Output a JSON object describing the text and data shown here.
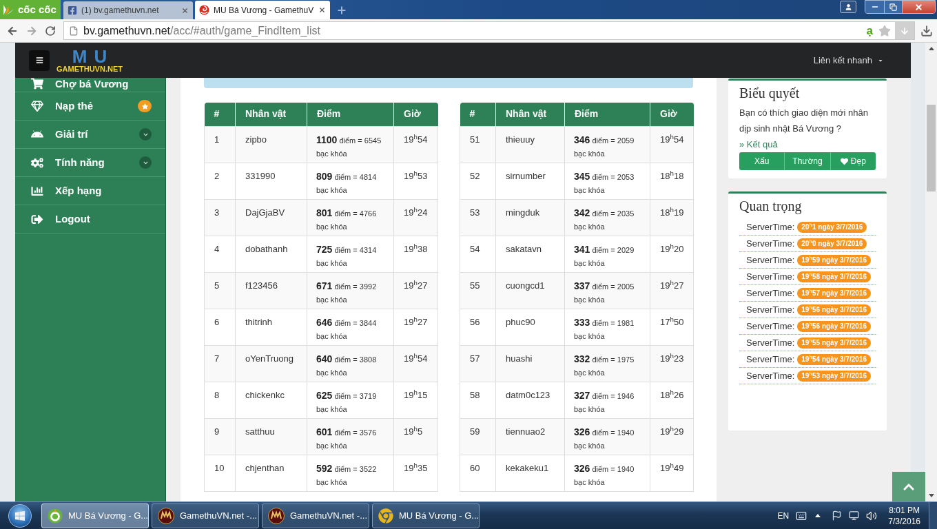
{
  "browser": {
    "brand": "cốc cốc",
    "tabs": [
      {
        "label": "(1) bv.gamethuvn.net",
        "selected": false
      },
      {
        "label": "MU Bá Vương - GamethuV",
        "selected": true
      }
    ],
    "url_host": "bv.gamethuvn.net",
    "url_path": "/acc/#auth/game_FindItem_list",
    "extension_label": "ạ"
  },
  "navbar": {
    "logo_backdrop": "MU",
    "logo_text": "GAMETHUVN.NET",
    "quick_links": "Liên kết nhanh"
  },
  "sidebar": {
    "items": [
      {
        "label": "Chợ bá Vương",
        "kind": "plain"
      },
      {
        "label": "Nạp thẻ",
        "kind": "badge"
      },
      {
        "label": "Giải trí",
        "kind": "submenu"
      },
      {
        "label": "Tính năng",
        "kind": "submenu"
      },
      {
        "label": "Xếp hạng",
        "kind": "plain"
      },
      {
        "label": "Logout",
        "kind": "plain"
      }
    ]
  },
  "tables": [
    {
      "columns": [
        "#",
        "Nhân vật",
        "Điểm",
        "Giờ"
      ],
      "rows": [
        {
          "rank": "1",
          "name": "zipbo",
          "score": "**1100** điểm = 6545 bạc khóa",
          "time": "19$^{h}$54"
        },
        {
          "rank": "2",
          "name": "331990",
          "score": "**809** điểm = 4814 bạc khóa",
          "time": "19$^{h}$53"
        },
        {
          "rank": "3",
          "name": "DajGjaBV",
          "score": "**801** điểm = 4766 bạc khóa",
          "time": "19$^{h}$24"
        },
        {
          "rank": "4",
          "name": "dobathanh",
          "score": "**725** điểm = 4314 bạc khóa",
          "time": "19$^{h}$38"
        },
        {
          "rank": "5",
          "name": "f123456",
          "score": "**671** điểm = 3992 bạc khóa",
          "time": "19$^{h}$27"
        },
        {
          "rank": "6",
          "name": "thitrinh",
          "score": "**646** điểm = 3844 bạc khóa",
          "time": "19$^{h}$27"
        },
        {
          "rank": "7",
          "name": "oYenTruong",
          "score": "**640** điểm = 3808 bạc khóa",
          "time": "19$^{h}$54"
        },
        {
          "rank": "8",
          "name": "chickenkc",
          "score": "**625** điểm = 3719 bạc khóa",
          "time": "19$^{h}$15"
        },
        {
          "rank": "9",
          "name": "satthuu",
          "score": "**601** điểm = 3576 bạc khóa",
          "time": "19$^{h}$5"
        },
        {
          "rank": "10",
          "name": "chjenthan",
          "score": "**592** điểm = 3522 bạc khóa",
          "time": "19$^{h}$35"
        }
      ]
    },
    {
      "columns": [
        "#",
        "Nhân vật",
        "Điểm",
        "Giờ"
      ],
      "rows": [
        {
          "rank": "51",
          "name": "thieuuy",
          "score": "**346** điểm = 2059 bạc khóa",
          "time": "19$^{h}$54"
        },
        {
          "rank": "52",
          "name": "sirnumber",
          "score": "**345** điểm = 2053 bạc khóa",
          "time": "18$^{h}$18"
        },
        {
          "rank": "53",
          "name": "mingduk",
          "score": "**342** điểm = 2035 bạc khóa",
          "time": "18$^{h}$19"
        },
        {
          "rank": "54",
          "name": "sakatavn",
          "score": "**341** điểm = 2029 bạc khóa",
          "time": "19$^{h}$20"
        },
        {
          "rank": "55",
          "name": "cuongcd1",
          "score": "**337** điểm = 2005 bạc khóa",
          "time": "19$^{h}$27"
        },
        {
          "rank": "56",
          "name": "phuc90",
          "score": "**333** điểm = 1981 bạc khóa",
          "time": "17$^{h}$50"
        },
        {
          "rank": "57",
          "name": "huashi",
          "score": "**332** điểm = 1975 bạc khóa",
          "time": "19$^{h}$23"
        },
        {
          "rank": "58",
          "name": "datm0c123",
          "score": "**327** điểm = 1946 bạc khóa",
          "time": "18$^{h}$26"
        },
        {
          "rank": "59",
          "name": "tiennuao2",
          "score": "**326** điểm = 1940 bạc khóa",
          "time": "19$^{h}$29"
        },
        {
          "rank": "60",
          "name": "kekakeku1",
          "score": "**326** điểm = 1940 bạc khóa",
          "time": "19$^{h}$49"
        }
      ]
    }
  ],
  "poll": {
    "title": "Biểu quyết",
    "question": "Bạn có thích giao diện mới nhân dịp sinh nhật Bá Vương ?",
    "result_link": "» Kết quả",
    "options": [
      "Xấu",
      "Thường",
      "Đẹp"
    ]
  },
  "important": {
    "title": "Quan trọng",
    "items": [
      {
        "label": "ServerTime:",
        "time": "20$^{h}$1 ngày 3/7/2016"
      },
      {
        "label": "ServerTime:",
        "time": "20$^{h}$0 ngày 3/7/2016"
      },
      {
        "label": "ServerTime:",
        "time": "19$^{h}$59 ngày 3/7/2016"
      },
      {
        "label": "ServerTime:",
        "time": "19$^{h}$58 ngày 3/7/2016"
      },
      {
        "label": "ServerTime:",
        "time": "19$^{h}$57 ngày 3/7/2016"
      },
      {
        "label": "ServerTime:",
        "time": "19$^{h}$56 ngày 3/7/2016"
      },
      {
        "label": "ServerTime:",
        "time": "19$^{h}$56 ngày 3/7/2016"
      },
      {
        "label": "ServerTime:",
        "time": "19$^{h}$55 ngày 3/7/2016"
      },
      {
        "label": "ServerTime:",
        "time": "19$^{h}$54 ngày 3/7/2016"
      },
      {
        "label": "ServerTime:",
        "time": "19$^{h}$53 ngày 3/7/2016"
      }
    ]
  },
  "taskbar": {
    "items": [
      {
        "label": "MU Bá Vương - G...",
        "selected": true
      },
      {
        "label": "GamethuVN.net -...",
        "selected": false
      },
      {
        "label": "GamethuVN.net -...",
        "selected": false
      },
      {
        "label": "MU Bá Vương - G...",
        "selected": false
      }
    ],
    "language": "EN",
    "time": "8:01 PM",
    "date": "7/3/2016"
  }
}
